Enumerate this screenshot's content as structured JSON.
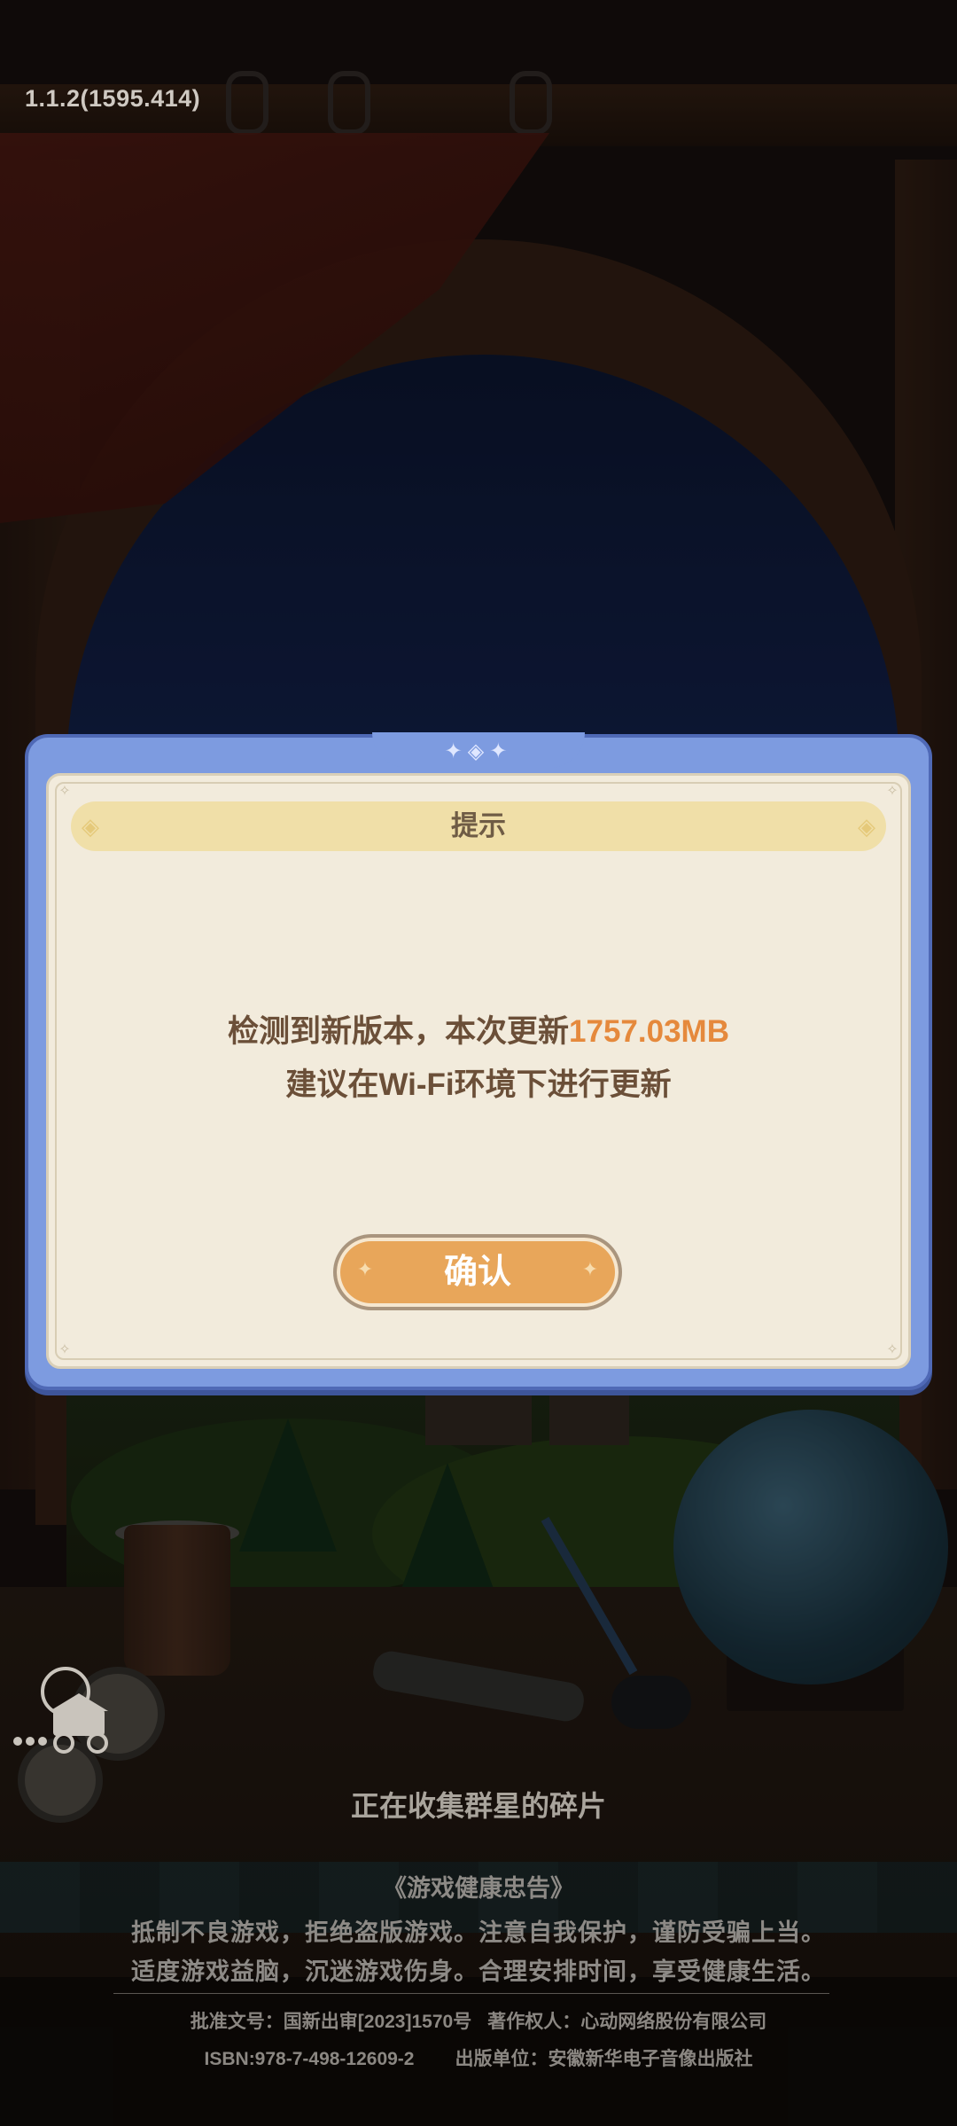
{
  "version": "1.1.2(1595.414)",
  "dialog": {
    "title": "提示",
    "message_prefix": "检测到新版本，本次更新",
    "update_size": "1757.03MB",
    "message_line2": "建议在Wi-Fi环境下进行更新",
    "confirm_label": "确认",
    "highlight_color": "#e5893c",
    "button_color": "#e8a65a"
  },
  "loading_text": "正在收集群星的碎片",
  "health_notice": {
    "title": "《游戏健康忠告》",
    "line1": "抵制不良游戏，拒绝盗版游戏。注意自我保护，谨防受骗上当。",
    "line2": "适度游戏益脑，沉迷游戏伤身。合理安排时间，享受健康生活。"
  },
  "legal": {
    "approval": "批准文号：国新出审[2023]1570号",
    "copyright": "著作权人：心动网络股份有限公司",
    "isbn": "ISBN:978-7-498-12609-2",
    "publisher": "出版单位：安徽新华电子音像出版社"
  }
}
